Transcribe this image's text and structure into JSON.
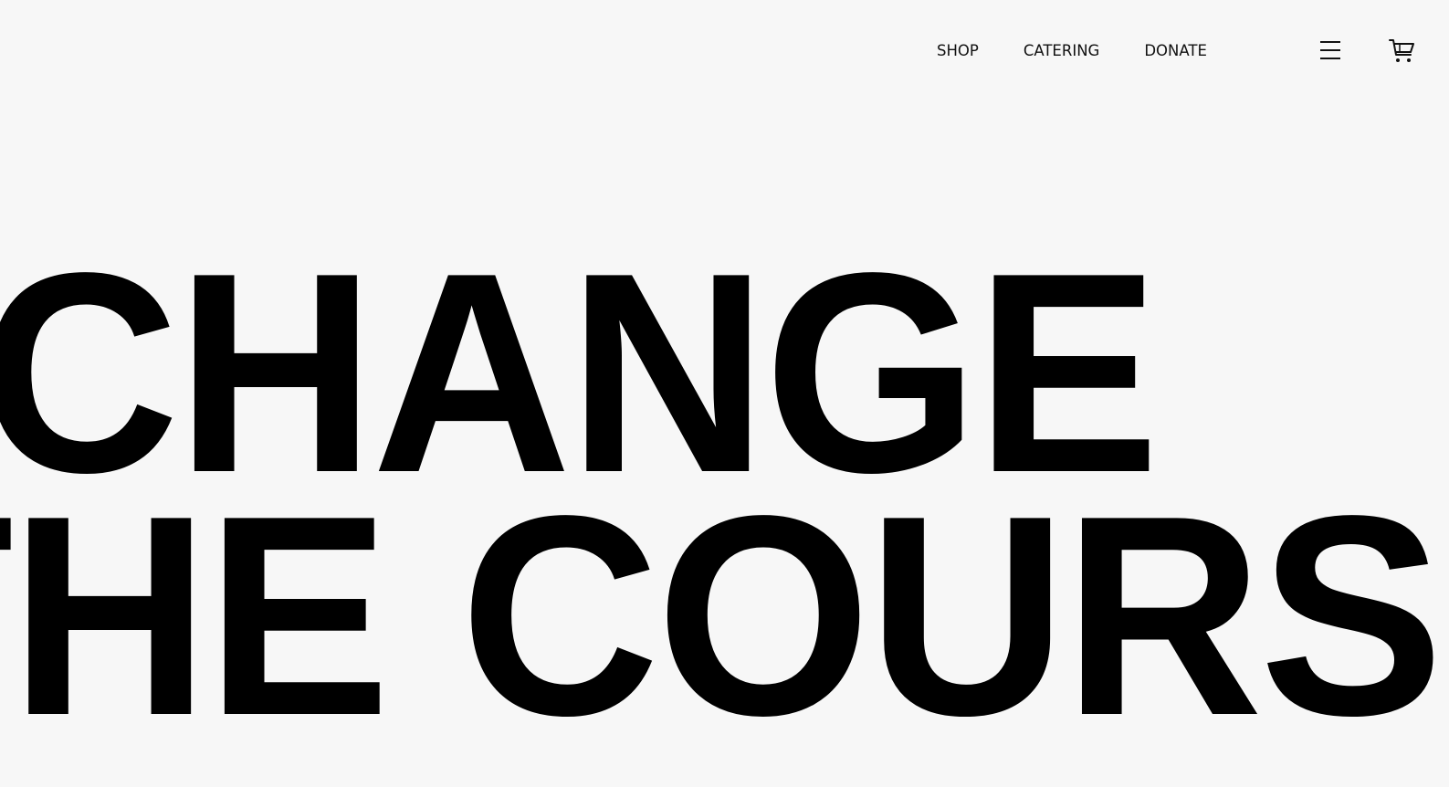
{
  "nav": {
    "links": [
      {
        "label": "SHOP"
      },
      {
        "label": "CATERING"
      },
      {
        "label": "DONATE"
      }
    ],
    "menu_icon": "hamburger-menu-icon",
    "cart_icon": "shopping-cart-icon"
  },
  "hero": {
    "line1": "CHANGE",
    "line2": "THE COURSE"
  },
  "colors": {
    "background": "#f7f7f7",
    "text": "#000000"
  }
}
